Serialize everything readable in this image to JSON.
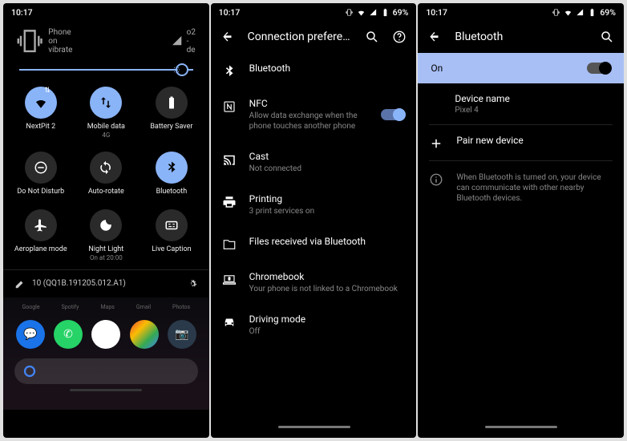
{
  "statusbar": {
    "time": "10:17",
    "battery": "69%"
  },
  "panel1": {
    "ringer": "Phone on vibrate",
    "carrier": "o2 - de",
    "tiles": [
      {
        "id": "wifi",
        "label": "NextPit 2",
        "sub": "",
        "on": true,
        "icon": "wifi",
        "arrows": true
      },
      {
        "id": "data",
        "label": "Mobile data",
        "sub": "4G",
        "on": true,
        "icon": "swap"
      },
      {
        "id": "battery",
        "label": "Battery Saver",
        "sub": "",
        "on": false,
        "icon": "battery"
      },
      {
        "id": "dnd",
        "label": "Do Not Disturb",
        "sub": "",
        "on": false,
        "icon": "dnd"
      },
      {
        "id": "rotate",
        "label": "Auto-rotate",
        "sub": "",
        "on": false,
        "icon": "rotate"
      },
      {
        "id": "bt",
        "label": "Bluetooth",
        "sub": "",
        "on": true,
        "icon": "bt"
      },
      {
        "id": "air",
        "label": "Aeroplane mode",
        "sub": "",
        "on": false,
        "icon": "plane"
      },
      {
        "id": "night",
        "label": "Night Light",
        "sub": "On at 20:00",
        "on": false,
        "icon": "moon"
      },
      {
        "id": "caption",
        "label": "Live Caption",
        "sub": "",
        "on": false,
        "icon": "caption"
      }
    ],
    "build": "10 (QQ1B.191205.012.A1)",
    "apps_top": [
      "Google",
      "Spotify",
      "Maps",
      "Gmail",
      "Photos"
    ]
  },
  "panel2": {
    "title": "Connection preferen…",
    "items": [
      {
        "icon": "bt",
        "primary": "Bluetooth",
        "secondary": ""
      },
      {
        "icon": "nfc",
        "primary": "NFC",
        "secondary": "Allow data exchange when the phone touches another phone",
        "toggle": true
      },
      {
        "icon": "cast",
        "primary": "Cast",
        "secondary": "Not connected"
      },
      {
        "icon": "print",
        "primary": "Printing",
        "secondary": "3 print services on"
      },
      {
        "icon": "folder",
        "primary": "Files received via Bluetooth",
        "secondary": ""
      },
      {
        "icon": "laptop",
        "primary": "Chromebook",
        "secondary": "Your phone is not linked to a Chromebook"
      },
      {
        "icon": "car",
        "primary": "Driving mode",
        "secondary": "Off"
      }
    ]
  },
  "panel3": {
    "title": "Bluetooth",
    "state": "On",
    "device_name_label": "Device name",
    "device_name": "Pixel 4",
    "pair": "Pair new device",
    "info": "When Bluetooth is turned on, your device can communicate with other nearby Bluetooth devices."
  }
}
